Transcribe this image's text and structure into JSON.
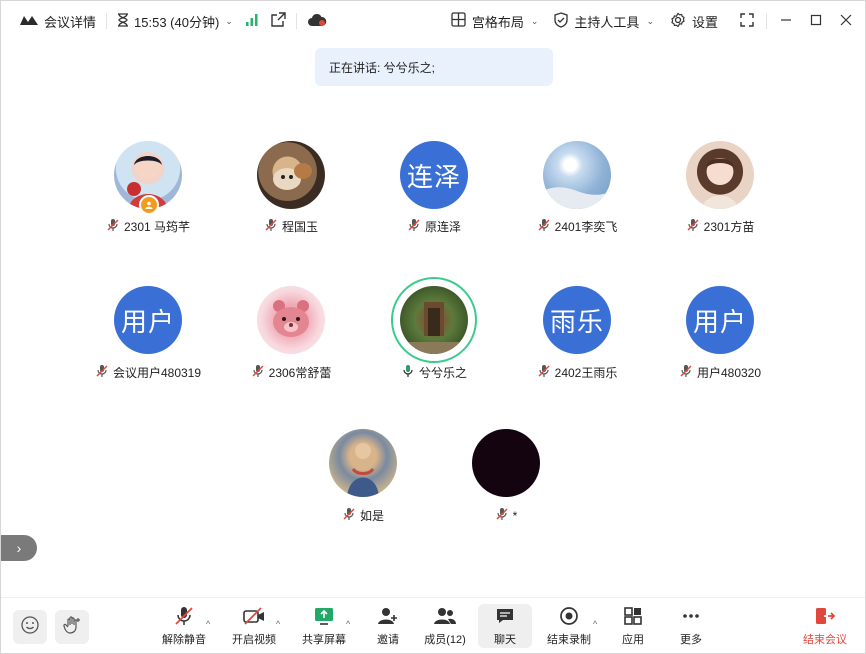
{
  "titlebar": {
    "meeting_details": "会议详情",
    "time": "15:53 (40分钟)",
    "layout": "宫格布局",
    "host_tools": "主持人工具",
    "settings": "设置"
  },
  "banner": {
    "speaking_text": "正在讲话: 兮兮乐之;"
  },
  "participants": [
    {
      "name": "2301 马筠芊",
      "initials": ""
    },
    {
      "name": "程国玉",
      "initials": ""
    },
    {
      "name": "原连泽",
      "initials": "连泽"
    },
    {
      "name": "2401李奕飞",
      "initials": ""
    },
    {
      "name": "2301方苗",
      "initials": ""
    },
    {
      "name": "会议用户480319",
      "initials": "用户"
    },
    {
      "name": "2306常舒蕾",
      "initials": ""
    },
    {
      "name": "兮兮乐之",
      "initials": ""
    },
    {
      "name": "2402王雨乐",
      "initials": "雨乐"
    },
    {
      "name": "用户480320",
      "initials": "用户"
    },
    {
      "name": "如是",
      "initials": ""
    },
    {
      "name": "*",
      "initials": ""
    }
  ],
  "toolbar": {
    "unmute": "解除静音",
    "start_video": "开启视频",
    "share_screen": "共享屏幕",
    "invite": "邀请",
    "members": "成员(12)",
    "chat": "聊天",
    "end_recording": "结束录制",
    "apps": "应用",
    "more": "更多",
    "end_meeting": "结束会议"
  },
  "colors": {
    "accent_blue": "#3a6fd6",
    "speaking_green": "#3bcb8d",
    "danger_red": "#e0483c",
    "host_orange": "#f39b1d"
  }
}
